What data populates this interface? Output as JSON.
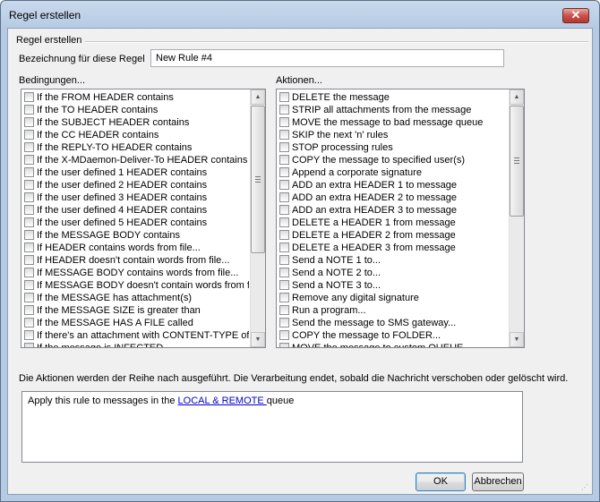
{
  "window": {
    "title": "Regel erstellen",
    "close_label": "✕"
  },
  "group": {
    "title": "Regel erstellen"
  },
  "rule_name": {
    "label": "Bezeichnung für diese Regel",
    "value": "New Rule #4"
  },
  "conditions": {
    "title": "Bedingungen...",
    "items": [
      "If the FROM HEADER contains",
      "If the TO HEADER contains",
      "If the SUBJECT HEADER contains",
      "If the CC HEADER contains",
      "If the REPLY-TO HEADER contains",
      "If the X-MDaemon-Deliver-To HEADER contains",
      "If the user defined 1 HEADER contains",
      "If the user defined 2 HEADER contains",
      "If the user defined 3 HEADER contains",
      "If the user defined 4 HEADER contains",
      "If the user defined 5 HEADER contains",
      "If the MESSAGE BODY contains",
      "If HEADER contains words from file...",
      "If HEADER doesn't contain words from file...",
      "If MESSAGE BODY contains words from file...",
      "If MESSAGE BODY doesn't contain words from file...",
      "If the MESSAGE has attachment(s)",
      "If the MESSAGE SIZE is greater than",
      "If the MESSAGE HAS A FILE called",
      "If there's an attachment with CONTENT-TYPE of...",
      "If the message is INFECTED"
    ]
  },
  "actions": {
    "title": "Aktionen...",
    "items": [
      "DELETE the message",
      "STRIP all attachments from the message",
      "MOVE the message to bad message queue",
      "SKIP the next 'n' rules",
      "STOP processing rules",
      "COPY the message to specified user(s)",
      "Append a corporate signature",
      "ADD an extra HEADER 1 to message",
      "ADD an extra HEADER 2 to message",
      "ADD an extra HEADER 3 to message",
      "DELETE a HEADER 1 from message",
      "DELETE a HEADER 2 from message",
      "DELETE a HEADER 3 from message",
      "Send a NOTE 1 to...",
      "Send a NOTE 2 to...",
      "Send a NOTE 3 to...",
      "Remove any digital signature",
      "Run a program...",
      "Send the message to SMS gateway...",
      "COPY the message to FOLDER...",
      "MOVE the message to custom QUEUE..."
    ]
  },
  "info_text": "Die Aktionen werden der Reihe nach ausgeführt. Die Verarbeitung endet, sobald die Nachricht verschoben oder gelöscht wird.",
  "description": {
    "prefix": "Apply this rule to messages in the ",
    "link": "LOCAL & REMOTE ",
    "suffix": " queue"
  },
  "buttons": {
    "ok": "OK",
    "cancel": "Abbrechen"
  }
}
